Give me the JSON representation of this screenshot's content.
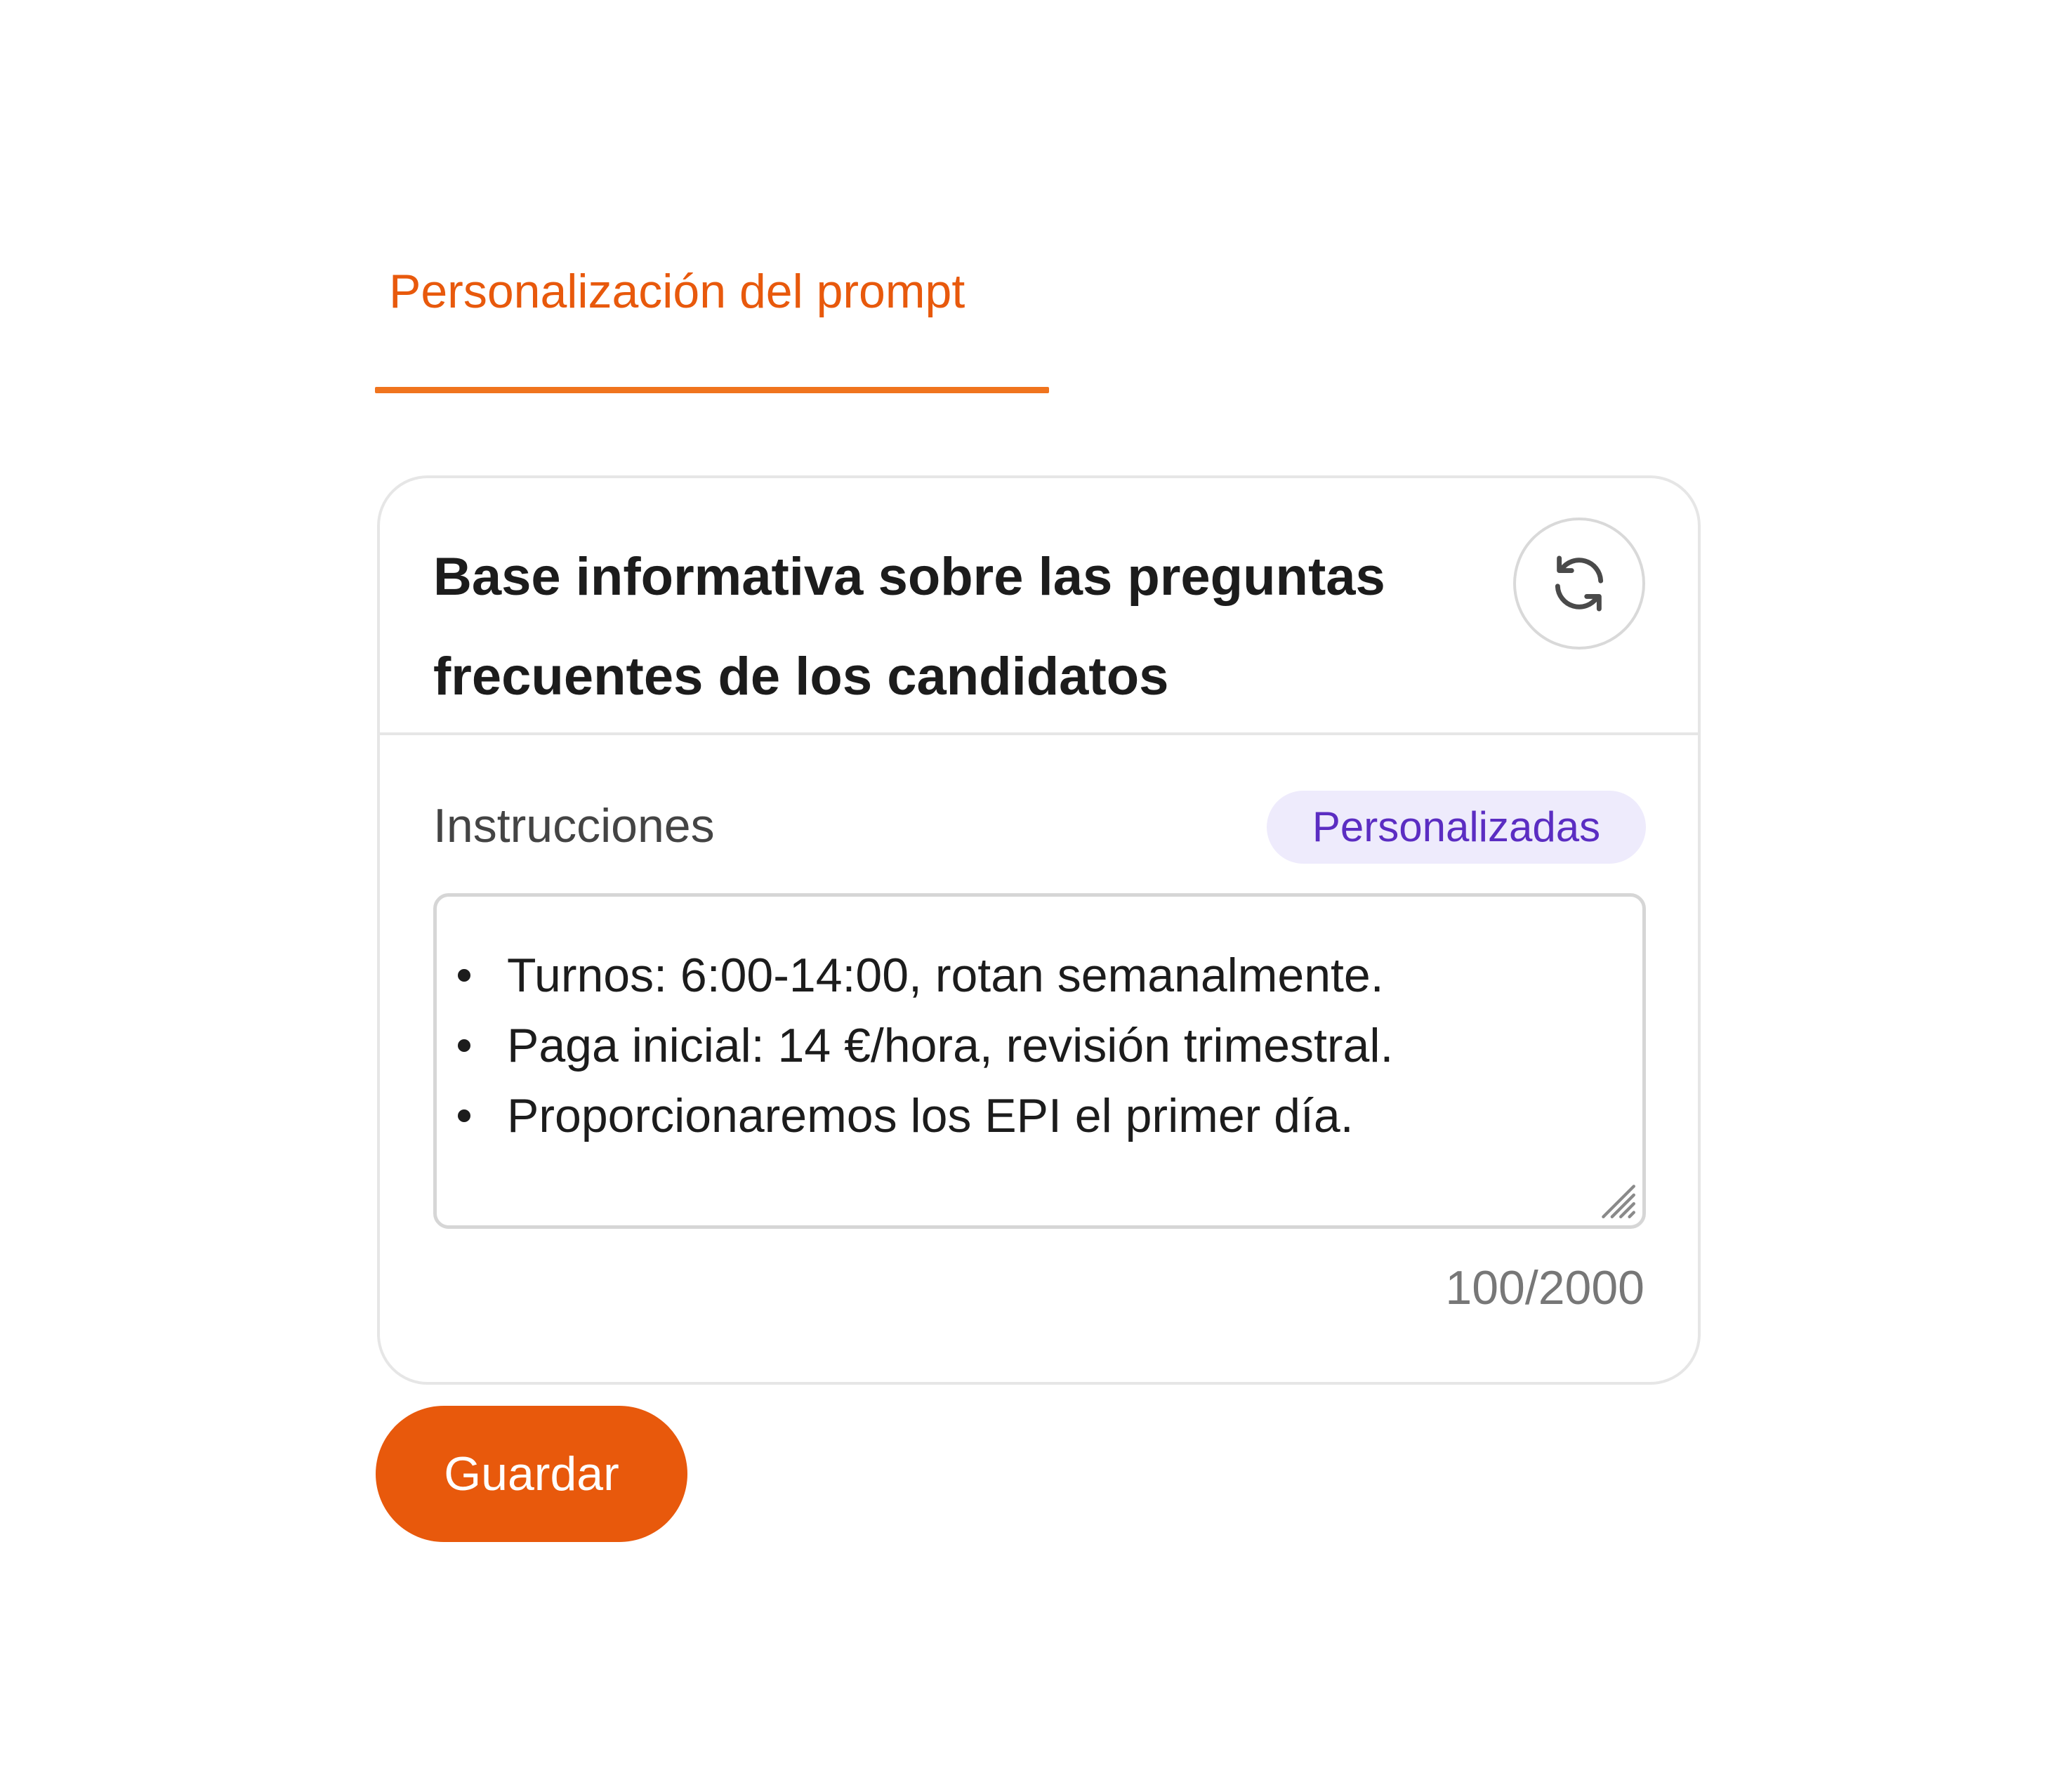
{
  "tabs": [
    {
      "label": "Personalización del prompt",
      "active": true
    }
  ],
  "card": {
    "title": "Base informativa sobre las preguntas frecuentes de los candidatos",
    "refresh_icon": "refresh-icon",
    "instructions_label": "Instrucciones",
    "badge": "Personalizadas",
    "instructions_items": [
      "Turnos: 6:00-14:00, rotan semanalmente.",
      "Paga inicial: 14 €/hora, revisión trimestral.",
      "Proporcionaremos los EPI el primer día."
    ],
    "char_counter": "100/2000"
  },
  "actions": {
    "save_label": "Guardar"
  },
  "colors": {
    "accent": "#E8590C",
    "badge_bg": "#EEEBFC",
    "badge_text": "#5B2DC2",
    "border": "#E6E6E6"
  }
}
